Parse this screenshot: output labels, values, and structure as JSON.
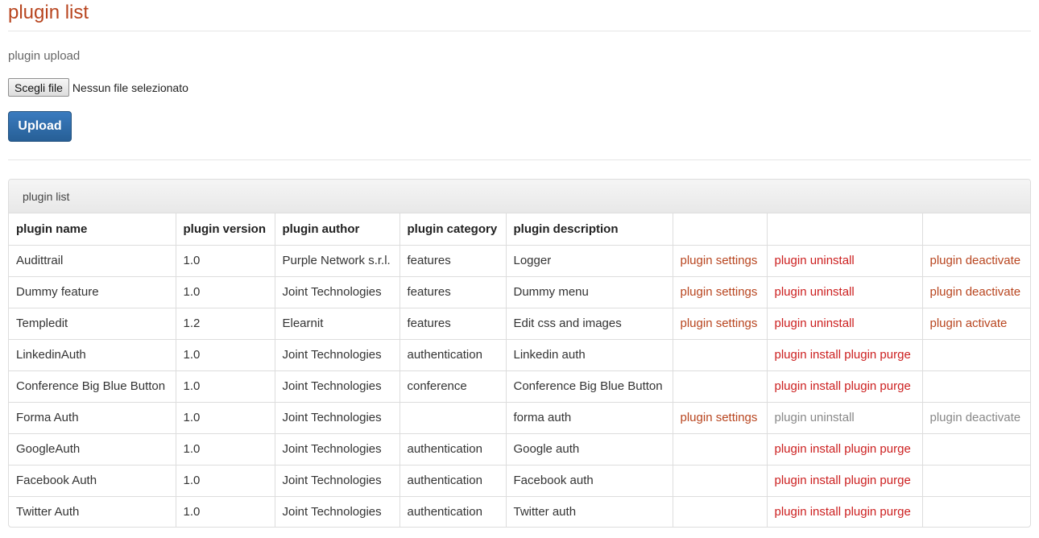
{
  "page": {
    "title": "plugin list"
  },
  "upload": {
    "label": "plugin upload",
    "file_button": "Scegli file",
    "file_status": "Nessun file selezionato",
    "upload_button": "Upload"
  },
  "panel": {
    "heading": "plugin list"
  },
  "table": {
    "headers": [
      "plugin name",
      "plugin version",
      "plugin author",
      "plugin category",
      "plugin description",
      "",
      "",
      ""
    ],
    "rows": [
      {
        "name": "Audittrail",
        "version": "1.0",
        "author": "Purple Network s.r.l.",
        "category": "features",
        "description": "Logger",
        "settings": "plugin settings",
        "install": "",
        "purge": "",
        "uninstall": "plugin uninstall",
        "toggle": "plugin deactivate"
      },
      {
        "name": "Dummy feature",
        "version": "1.0",
        "author": "Joint Technologies",
        "category": "features",
        "description": "Dummy menu",
        "settings": "plugin settings",
        "install": "",
        "purge": "",
        "uninstall": "plugin uninstall",
        "toggle": "plugin deactivate"
      },
      {
        "name": "Templedit",
        "version": "1.2",
        "author": "Elearnit",
        "category": "features",
        "description": "Edit css and images",
        "settings": "plugin settings",
        "install": "",
        "purge": "",
        "uninstall": "plugin uninstall",
        "toggle": "plugin activate"
      },
      {
        "name": "LinkedinAuth",
        "version": "1.0",
        "author": "Joint Technologies",
        "category": "authentication",
        "description": "Linkedin auth",
        "settings": "",
        "install": "plugin install",
        "purge": "plugin purge",
        "uninstall": "",
        "toggle": ""
      },
      {
        "name": "Conference Big Blue Button",
        "version": "1.0",
        "author": "Joint Technologies",
        "category": "conference",
        "description": "Conference Big Blue Button",
        "settings": "",
        "install": "plugin install",
        "purge": "plugin purge",
        "uninstall": "",
        "toggle": ""
      },
      {
        "name": "Forma Auth",
        "version": "1.0",
        "author": "Joint Technologies",
        "category": "",
        "description": "forma auth",
        "settings": "plugin settings",
        "install": "",
        "purge": "",
        "uninstall": "plugin uninstall",
        "toggle": "plugin deactivate",
        "disabled": true
      },
      {
        "name": "GoogleAuth",
        "version": "1.0",
        "author": "Joint Technologies",
        "category": "authentication",
        "description": "Google auth",
        "settings": "",
        "install": "plugin install",
        "purge": "plugin purge",
        "uninstall": "",
        "toggle": ""
      },
      {
        "name": "Facebook Auth",
        "version": "1.0",
        "author": "Joint Technologies",
        "category": "authentication",
        "description": "Facebook auth",
        "settings": "",
        "install": "plugin install",
        "purge": "plugin purge",
        "uninstall": "",
        "toggle": ""
      },
      {
        "name": "Twitter Auth",
        "version": "1.0",
        "author": "Joint Technologies",
        "category": "authentication",
        "description": "Twitter auth",
        "settings": "",
        "install": "plugin install",
        "purge": "plugin purge",
        "uninstall": "",
        "toggle": ""
      }
    ]
  },
  "colors": {
    "link": "#b8451f",
    "danger_link": "#cc1f1f",
    "muted_link": "#888888",
    "primary_button": "#2f6eab"
  }
}
